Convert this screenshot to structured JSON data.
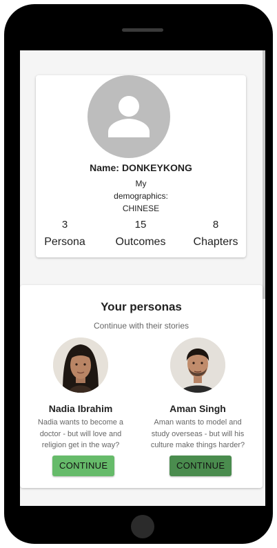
{
  "profile": {
    "name_label": "Name:",
    "name_value": "DONKEYKONG",
    "demographics_line1": "My",
    "demographics_line2": "demographics:",
    "demographics_value": "CHINESE",
    "stats": [
      {
        "value": "3",
        "label": "Persona"
      },
      {
        "value": "15",
        "label": "Outcomes"
      },
      {
        "value": "8",
        "label": "Chapters"
      }
    ]
  },
  "personas_section": {
    "title": "Your personas",
    "subtitle": "Continue with their stories",
    "items": [
      {
        "name": "Nadia Ibrahim",
        "description": "Nadia wants to become a doctor - but will love and religion get in the way?",
        "button_label": "CONTINUE",
        "button_color": "#66bb6a"
      },
      {
        "name": "Aman Singh",
        "description": "Aman wants to model and study overseas - but will his culture make things harder?",
        "button_label": "CONTINUE",
        "button_color": "#4a8c4e"
      }
    ]
  },
  "icons": {
    "avatar": "user-placeholder-icon"
  }
}
